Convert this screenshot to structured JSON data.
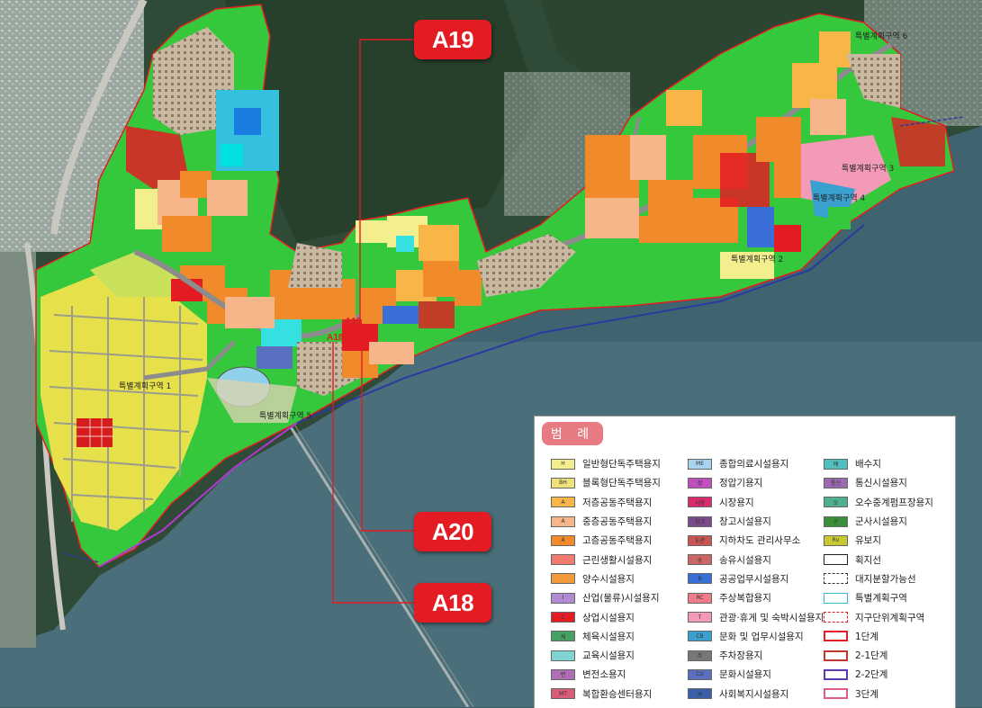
{
  "callouts": {
    "a19": "A19",
    "a20": "A20",
    "a18": "A18"
  },
  "map_tags": {
    "a19": "A19",
    "a18": "A18",
    "a20": "A20"
  },
  "zones": {
    "z1": "특별계획구역 1",
    "z2": "특별계획구역 2",
    "z3": "특별계획구역 3",
    "z4": "특별계획구역 4",
    "z5": "특별계획구역 5",
    "z6": "특별계획구역 6"
  },
  "legend": {
    "title": "범 례",
    "col1": [
      {
        "code": "H",
        "label": "일반형단독주택용지",
        "color": "#f4ef8e"
      },
      {
        "code": "BH",
        "label": "블록형단독주택용지",
        "color": "#efe27a"
      },
      {
        "code": "A",
        "label": "저층공동주택용지",
        "color": "#f8b648"
      },
      {
        "code": "A",
        "label": "중층공동주택용지",
        "color": "#f7b68a"
      },
      {
        "code": "A",
        "label": "고층공동주택용지",
        "color": "#f08a2a"
      },
      {
        "code": "",
        "label": "근린생활시설용지",
        "color": "#f07b6e"
      },
      {
        "code": "",
        "label": "양수시설용지",
        "color": "#f29a3a"
      },
      {
        "code": "I",
        "label": "산업(물류)시설용지",
        "color": "#b18bd1"
      },
      {
        "code": "C",
        "label": "상업시설용지",
        "color": "#e31b23"
      },
      {
        "code": "체",
        "label": "체육시설용지",
        "color": "#49a065"
      },
      {
        "code": "",
        "label": "교육시설용지",
        "color": "#7fd3d3"
      },
      {
        "code": "변",
        "label": "변전소용지",
        "color": "#b06fb4"
      },
      {
        "code": "MT",
        "label": "복합환승센터용지",
        "color": "#d85c78"
      }
    ],
    "col2": [
      {
        "code": "ME",
        "label": "종합의료시설용지",
        "color": "#a8d3ef"
      },
      {
        "code": "정",
        "label": "정압기용지",
        "color": "#c14fc0"
      },
      {
        "code": "시장",
        "label": "시장용지",
        "color": "#d82a6c"
      },
      {
        "code": "창고",
        "label": "창고시설용지",
        "color": "#7b4b8b"
      },
      {
        "code": "도관",
        "label": "지하차도 관리사무소",
        "color": "#c95454"
      },
      {
        "code": "송",
        "label": "송유시설용지",
        "color": "#cc6666"
      },
      {
        "code": "B",
        "label": "공공업무시설용지",
        "color": "#3a6fd8"
      },
      {
        "code": "RC",
        "label": "주상복합용지",
        "color": "#f07b8b"
      },
      {
        "code": "T",
        "label": "관광·휴게 및 숙박시설용지",
        "color": "#f39ab6"
      },
      {
        "code": "CB",
        "label": "문화 및 업무시설용지",
        "color": "#3aa0cf"
      },
      {
        "code": "주",
        "label": "주차장용지",
        "color": "#777777"
      },
      {
        "code": "CU",
        "label": "문화시설용지",
        "color": "#5a6fbf"
      },
      {
        "code": "복",
        "label": "사회복지시설용지",
        "color": "#3a5fa8"
      }
    ],
    "col3": [
      {
        "code": "배",
        "label": "배수지",
        "color": "#4fbfbf"
      },
      {
        "code": "통신",
        "label": "통신시설용지",
        "color": "#9b6ab0"
      },
      {
        "code": "오",
        "label": "오수중계펌프장용지",
        "color": "#4faf8f"
      },
      {
        "code": "군",
        "label": "군사시설용지",
        "color": "#3a8f3a"
      },
      {
        "code": "Rv",
        "label": "유보지",
        "color": "#c8c832"
      },
      {
        "code": "",
        "label": "획지선",
        "color": "line-black"
      },
      {
        "code": "",
        "label": "대지분할가능선",
        "color": "line-dash"
      },
      {
        "code": "",
        "label": "특별계획구역",
        "color": "line-cyan"
      },
      {
        "code": "",
        "label": "지구단위계획구역",
        "color": "line-reddash"
      },
      {
        "code": "",
        "label": "1단계",
        "color": "line-red"
      },
      {
        "code": "",
        "label": "2-1단계",
        "color": "line-red2"
      },
      {
        "code": "",
        "label": "2-2단계",
        "color": "line-purple"
      },
      {
        "code": "",
        "label": "3단계",
        "color": "line-pink"
      }
    ]
  }
}
